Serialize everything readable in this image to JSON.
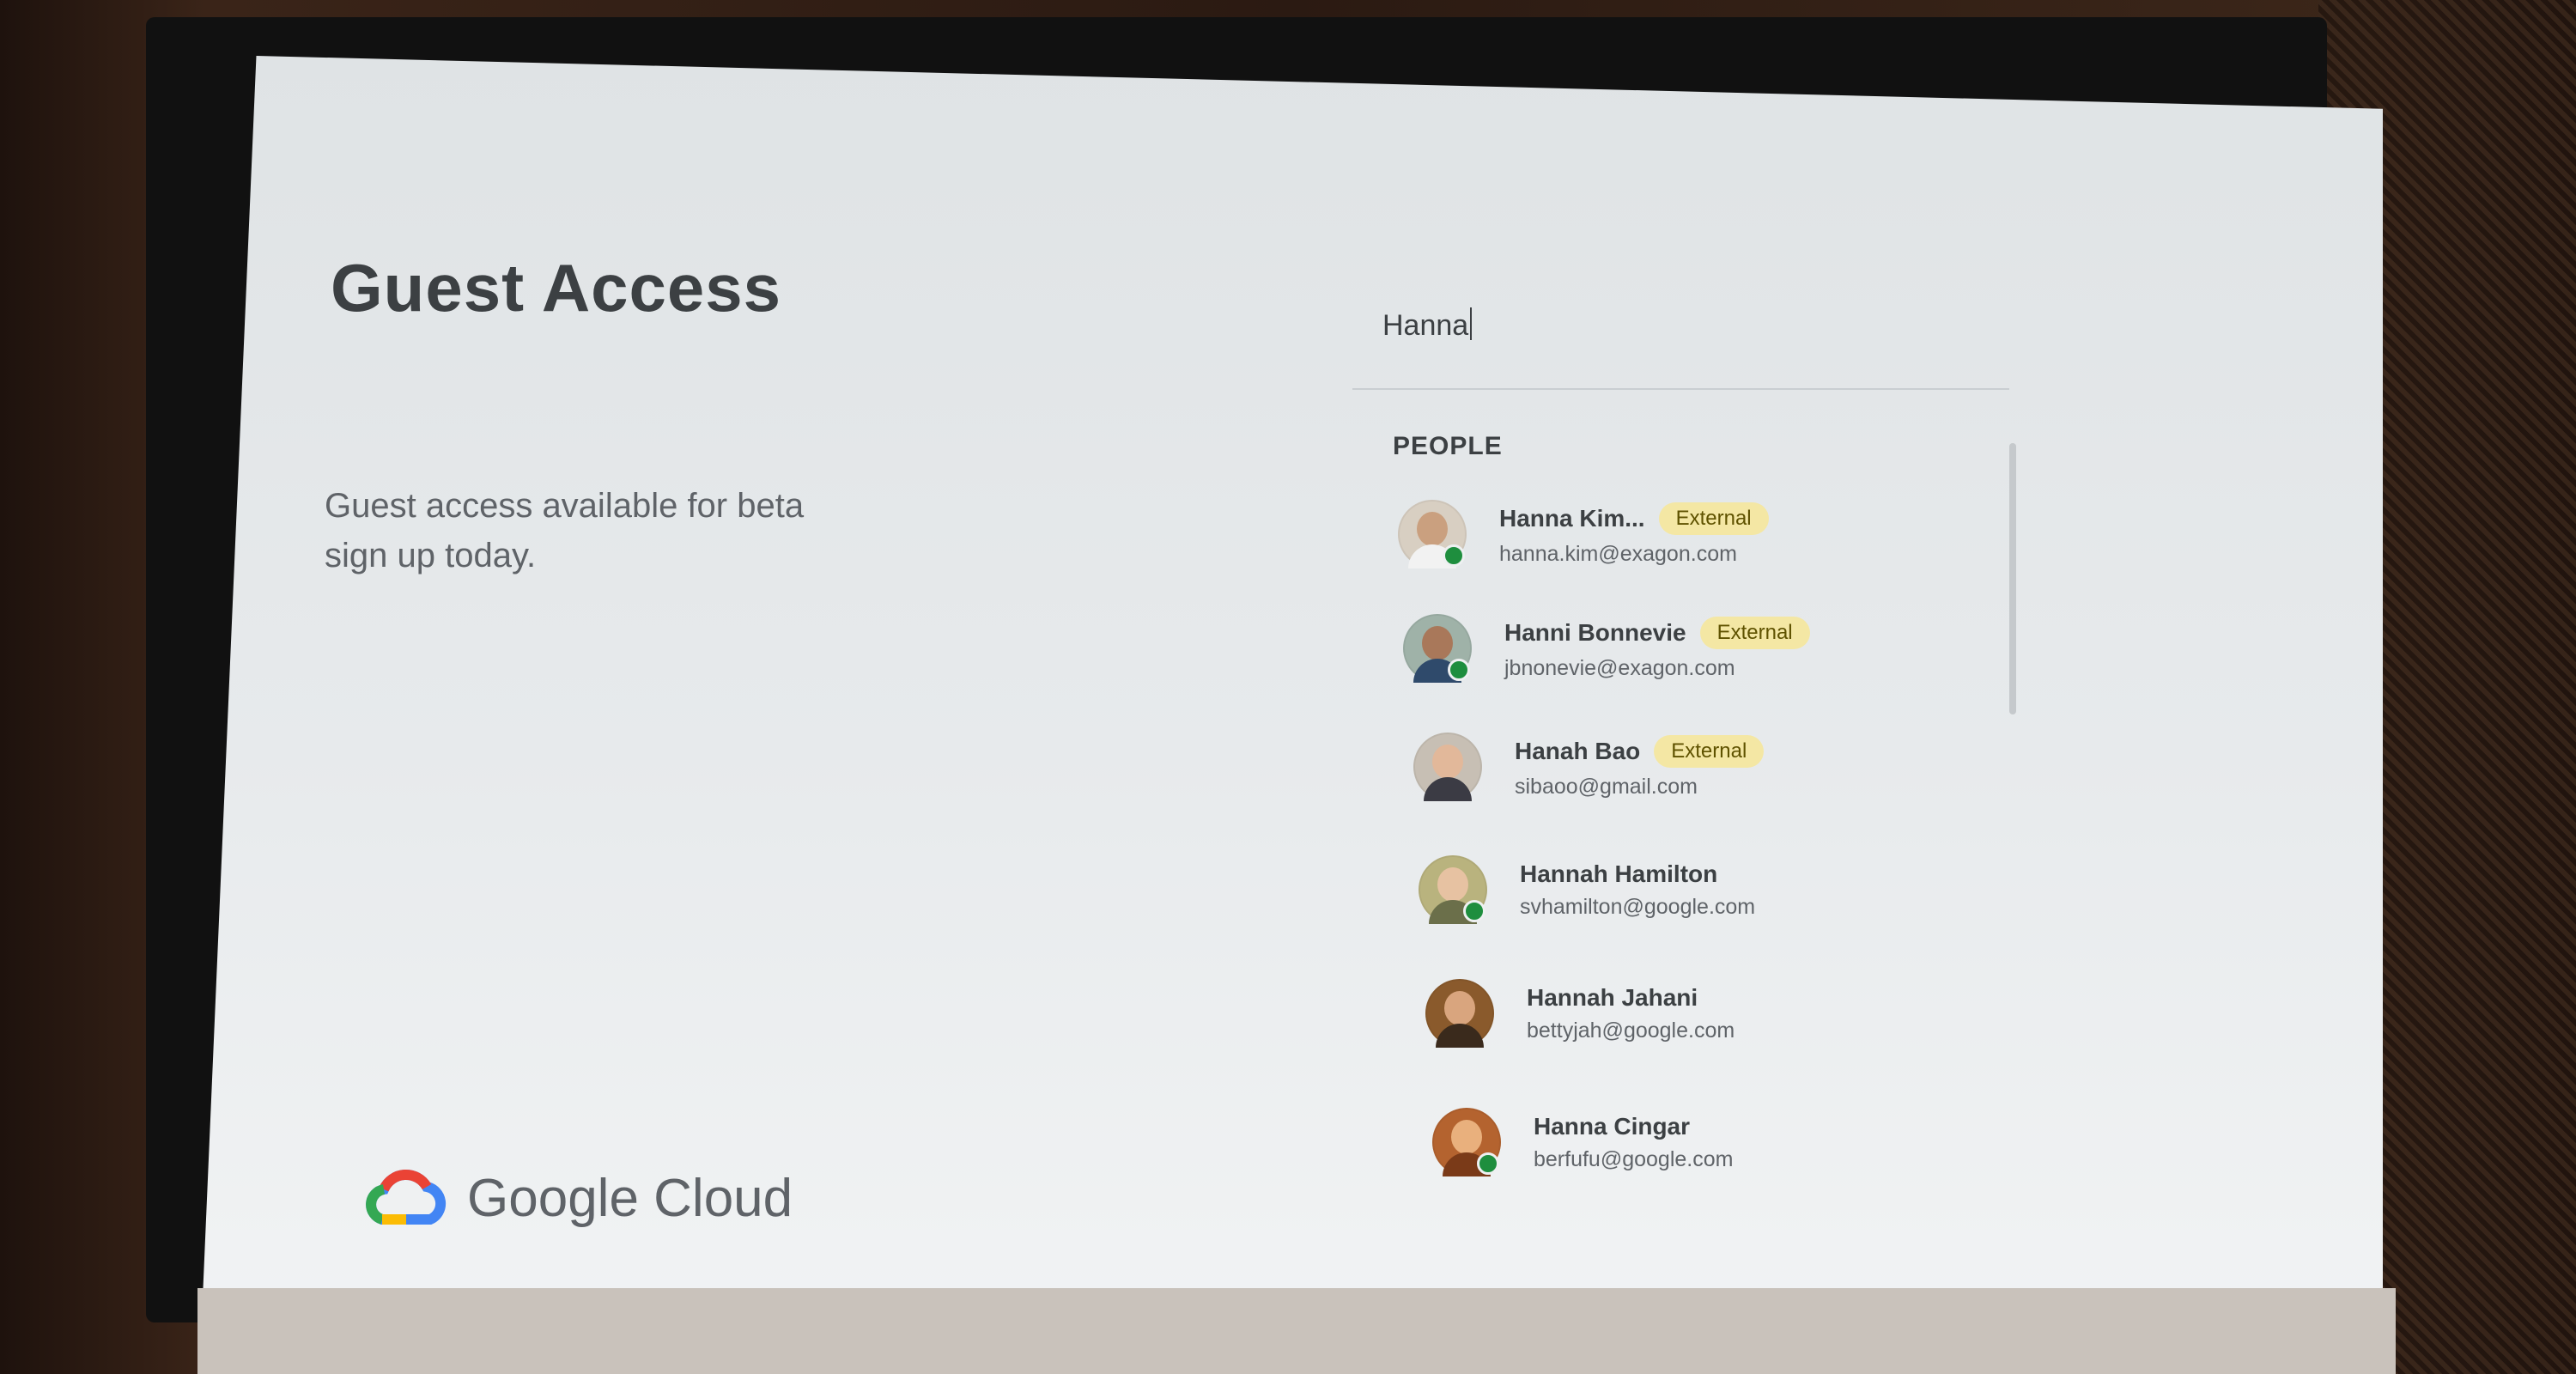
{
  "slide": {
    "title": "Guest Access",
    "subtitle": "Guest access available for beta sign up today.",
    "brand": "Google Cloud"
  },
  "search": {
    "value": "Hanna"
  },
  "results": {
    "section_label": "PEOPLE",
    "people": [
      {
        "name": "Hanna Kim...",
        "badge": "External",
        "email": "hanna.kim@exagon.com",
        "online": true
      },
      {
        "name": "Hanni Bonnevie",
        "badge": "External",
        "email": "jbnonevie@exagon.com",
        "online": true
      },
      {
        "name": "Hanah Bao",
        "badge": "External",
        "email": "sibaoo@gmail.com",
        "online": false
      },
      {
        "name": "Hannah Hamilton",
        "badge": "",
        "email": "svhamilton@google.com",
        "online": true
      },
      {
        "name": "Hannah Jahani",
        "badge": "",
        "email": "bettyjah@google.com",
        "online": false
      },
      {
        "name": "Hanna Cingar",
        "badge": "",
        "email": "berfufu@google.com",
        "online": true
      }
    ]
  },
  "colors": {
    "badge_bg": "#f4e7a4",
    "presence": "#1e8e3e",
    "text_primary": "#3c4043",
    "text_secondary": "#5f6368"
  },
  "icons": {
    "brand_logo": "google-cloud-logo-icon",
    "presence": "online-status-icon"
  }
}
